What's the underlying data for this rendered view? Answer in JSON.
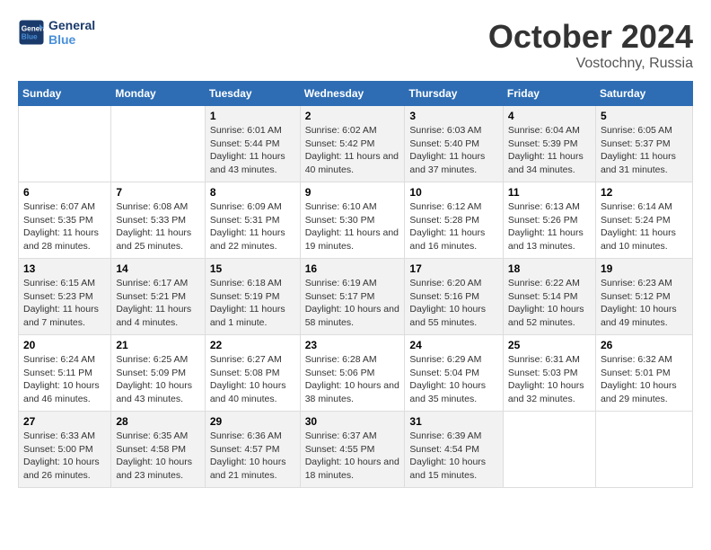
{
  "logo": {
    "line1": "General",
    "line2": "Blue"
  },
  "title": "October 2024",
  "location": "Vostochny, Russia",
  "days_header": [
    "Sunday",
    "Monday",
    "Tuesday",
    "Wednesday",
    "Thursday",
    "Friday",
    "Saturday"
  ],
  "weeks": [
    [
      {
        "day": "",
        "info": ""
      },
      {
        "day": "",
        "info": ""
      },
      {
        "day": "1",
        "info": "Sunrise: 6:01 AM\nSunset: 5:44 PM\nDaylight: 11 hours and 43 minutes."
      },
      {
        "day": "2",
        "info": "Sunrise: 6:02 AM\nSunset: 5:42 PM\nDaylight: 11 hours and 40 minutes."
      },
      {
        "day": "3",
        "info": "Sunrise: 6:03 AM\nSunset: 5:40 PM\nDaylight: 11 hours and 37 minutes."
      },
      {
        "day": "4",
        "info": "Sunrise: 6:04 AM\nSunset: 5:39 PM\nDaylight: 11 hours and 34 minutes."
      },
      {
        "day": "5",
        "info": "Sunrise: 6:05 AM\nSunset: 5:37 PM\nDaylight: 11 hours and 31 minutes."
      }
    ],
    [
      {
        "day": "6",
        "info": "Sunrise: 6:07 AM\nSunset: 5:35 PM\nDaylight: 11 hours and 28 minutes."
      },
      {
        "day": "7",
        "info": "Sunrise: 6:08 AM\nSunset: 5:33 PM\nDaylight: 11 hours and 25 minutes."
      },
      {
        "day": "8",
        "info": "Sunrise: 6:09 AM\nSunset: 5:31 PM\nDaylight: 11 hours and 22 minutes."
      },
      {
        "day": "9",
        "info": "Sunrise: 6:10 AM\nSunset: 5:30 PM\nDaylight: 11 hours and 19 minutes."
      },
      {
        "day": "10",
        "info": "Sunrise: 6:12 AM\nSunset: 5:28 PM\nDaylight: 11 hours and 16 minutes."
      },
      {
        "day": "11",
        "info": "Sunrise: 6:13 AM\nSunset: 5:26 PM\nDaylight: 11 hours and 13 minutes."
      },
      {
        "day": "12",
        "info": "Sunrise: 6:14 AM\nSunset: 5:24 PM\nDaylight: 11 hours and 10 minutes."
      }
    ],
    [
      {
        "day": "13",
        "info": "Sunrise: 6:15 AM\nSunset: 5:23 PM\nDaylight: 11 hours and 7 minutes."
      },
      {
        "day": "14",
        "info": "Sunrise: 6:17 AM\nSunset: 5:21 PM\nDaylight: 11 hours and 4 minutes."
      },
      {
        "day": "15",
        "info": "Sunrise: 6:18 AM\nSunset: 5:19 PM\nDaylight: 11 hours and 1 minute."
      },
      {
        "day": "16",
        "info": "Sunrise: 6:19 AM\nSunset: 5:17 PM\nDaylight: 10 hours and 58 minutes."
      },
      {
        "day": "17",
        "info": "Sunrise: 6:20 AM\nSunset: 5:16 PM\nDaylight: 10 hours and 55 minutes."
      },
      {
        "day": "18",
        "info": "Sunrise: 6:22 AM\nSunset: 5:14 PM\nDaylight: 10 hours and 52 minutes."
      },
      {
        "day": "19",
        "info": "Sunrise: 6:23 AM\nSunset: 5:12 PM\nDaylight: 10 hours and 49 minutes."
      }
    ],
    [
      {
        "day": "20",
        "info": "Sunrise: 6:24 AM\nSunset: 5:11 PM\nDaylight: 10 hours and 46 minutes."
      },
      {
        "day": "21",
        "info": "Sunrise: 6:25 AM\nSunset: 5:09 PM\nDaylight: 10 hours and 43 minutes."
      },
      {
        "day": "22",
        "info": "Sunrise: 6:27 AM\nSunset: 5:08 PM\nDaylight: 10 hours and 40 minutes."
      },
      {
        "day": "23",
        "info": "Sunrise: 6:28 AM\nSunset: 5:06 PM\nDaylight: 10 hours and 38 minutes."
      },
      {
        "day": "24",
        "info": "Sunrise: 6:29 AM\nSunset: 5:04 PM\nDaylight: 10 hours and 35 minutes."
      },
      {
        "day": "25",
        "info": "Sunrise: 6:31 AM\nSunset: 5:03 PM\nDaylight: 10 hours and 32 minutes."
      },
      {
        "day": "26",
        "info": "Sunrise: 6:32 AM\nSunset: 5:01 PM\nDaylight: 10 hours and 29 minutes."
      }
    ],
    [
      {
        "day": "27",
        "info": "Sunrise: 6:33 AM\nSunset: 5:00 PM\nDaylight: 10 hours and 26 minutes."
      },
      {
        "day": "28",
        "info": "Sunrise: 6:35 AM\nSunset: 4:58 PM\nDaylight: 10 hours and 23 minutes."
      },
      {
        "day": "29",
        "info": "Sunrise: 6:36 AM\nSunset: 4:57 PM\nDaylight: 10 hours and 21 minutes."
      },
      {
        "day": "30",
        "info": "Sunrise: 6:37 AM\nSunset: 4:55 PM\nDaylight: 10 hours and 18 minutes."
      },
      {
        "day": "31",
        "info": "Sunrise: 6:39 AM\nSunset: 4:54 PM\nDaylight: 10 hours and 15 minutes."
      },
      {
        "day": "",
        "info": ""
      },
      {
        "day": "",
        "info": ""
      }
    ]
  ]
}
